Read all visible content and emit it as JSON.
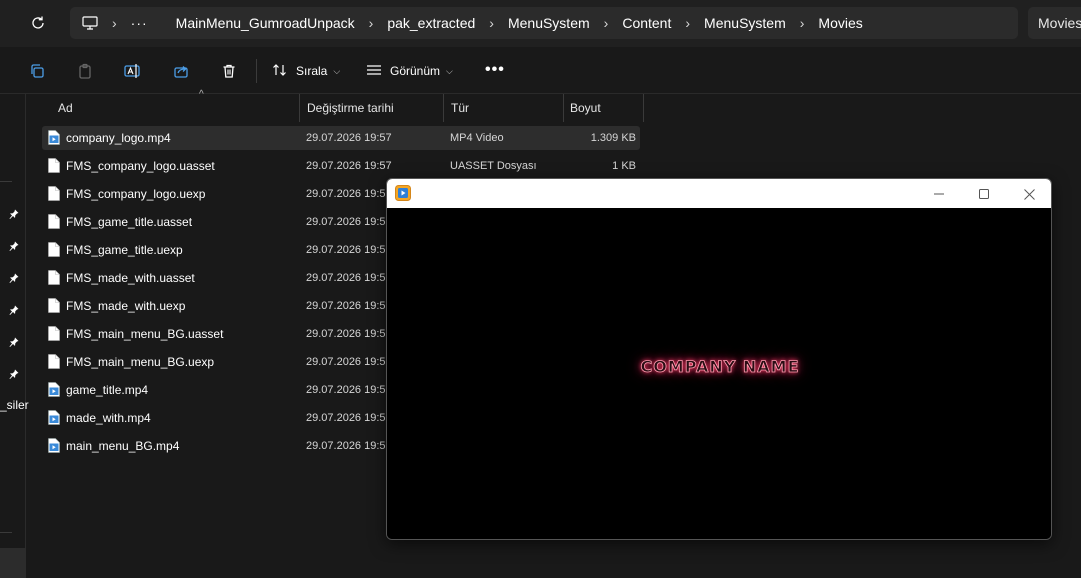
{
  "breadcrumb": [
    "MainMenu_GumroadUnpack",
    "pak_extracted",
    "MenuSystem",
    "Content",
    "MenuSystem",
    "Movies"
  ],
  "search_placeholder": "Movies",
  "toolbar": {
    "sort_label": "Sırala",
    "view_label": "Görünüm"
  },
  "columns": {
    "name": "Ad",
    "date": "Değiştirme tarihi",
    "type": "Tür",
    "size": "Boyut"
  },
  "files": [
    {
      "name": "company_logo.mp4",
      "date": "29.07.2026 19:57",
      "type": "MP4 Video",
      "size": "1.309 KB",
      "kind": "video"
    },
    {
      "name": "FMS_company_logo.uasset",
      "date": "29.07.2026 19:57",
      "type": "UASSET Dosyası",
      "size": "1 KB",
      "kind": "file"
    },
    {
      "name": "FMS_company_logo.uexp",
      "date": "29.07.2026 19:57",
      "type": "",
      "size": "",
      "kind": "file"
    },
    {
      "name": "FMS_game_title.uasset",
      "date": "29.07.2026 19:57",
      "type": "",
      "size": "",
      "kind": "file"
    },
    {
      "name": "FMS_game_title.uexp",
      "date": "29.07.2026 19:57",
      "type": "",
      "size": "",
      "kind": "file"
    },
    {
      "name": "FMS_made_with.uasset",
      "date": "29.07.2026 19:57",
      "type": "",
      "size": "",
      "kind": "file"
    },
    {
      "name": "FMS_made_with.uexp",
      "date": "29.07.2026 19:57",
      "type": "",
      "size": "",
      "kind": "file"
    },
    {
      "name": "FMS_main_menu_BG.uasset",
      "date": "29.07.2026 19:57",
      "type": "",
      "size": "",
      "kind": "file"
    },
    {
      "name": "FMS_main_menu_BG.uexp",
      "date": "29.07.2026 19:57",
      "type": "",
      "size": "",
      "kind": "file"
    },
    {
      "name": "game_title.mp4",
      "date": "29.07.2026 19:57",
      "type": "",
      "size": "",
      "kind": "video"
    },
    {
      "name": "made_with.mp4",
      "date": "29.07.2026 19:57",
      "type": "",
      "size": "",
      "kind": "video"
    },
    {
      "name": "main_menu_BG.mp4",
      "date": "29.07.2026 19:57",
      "type": "",
      "size": "",
      "kind": "video"
    }
  ],
  "nav_partial_label": "_siler",
  "player": {
    "video_text": "COMPANY NAME"
  },
  "icons": {
    "refresh": "refresh-icon",
    "computer": "computer-icon",
    "copy": "copy-icon",
    "paste": "paste-icon",
    "rename": "rename-icon",
    "share": "share-icon",
    "delete": "trash-icon",
    "sort": "sort-icon",
    "view": "view-icon",
    "pin": "pin-icon",
    "video_file": "video-file-icon",
    "generic_file": "file-icon"
  },
  "colors": {
    "accent": "#4c9ee8",
    "selected_row": "#2d2d2d",
    "neon_text": "#ff3f6a"
  }
}
